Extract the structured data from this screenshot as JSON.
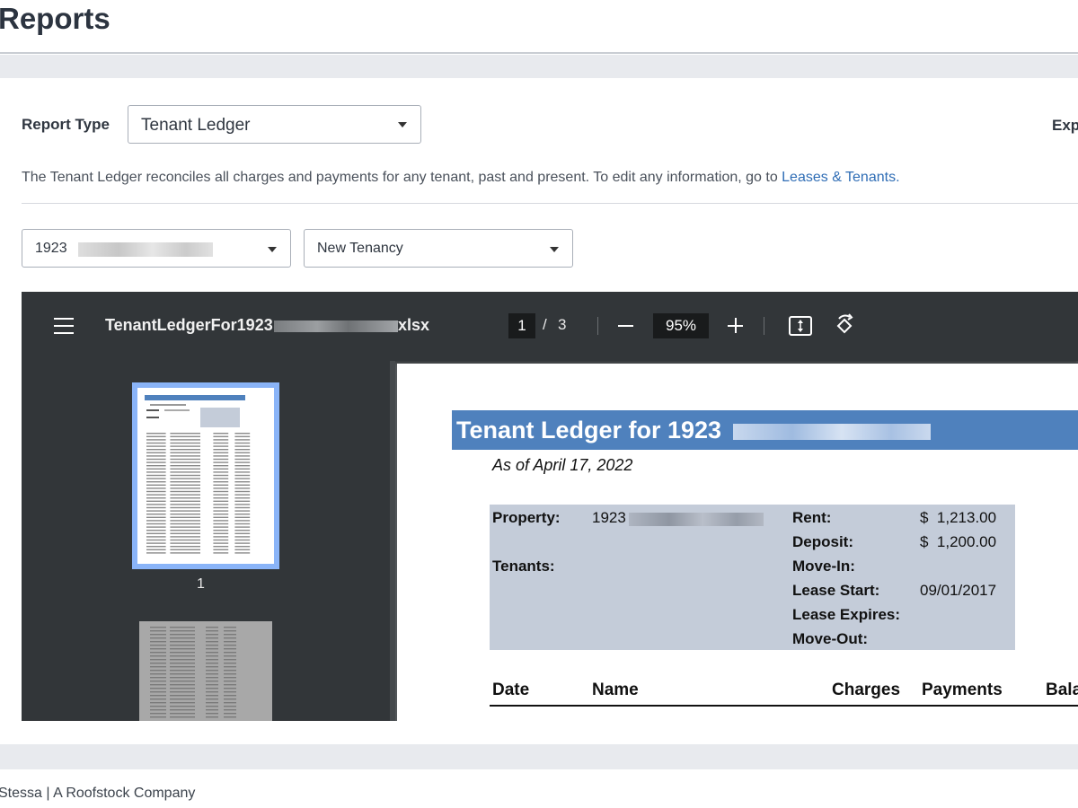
{
  "header": {
    "title": "Reports"
  },
  "report": {
    "type_label": "Report Type",
    "type_value": "Tenant Ledger",
    "export_label": "Exp",
    "description": "The Tenant Ledger reconciles all charges and payments for any tenant, past and present. To edit any information, go to ",
    "description_link": "Leases & Tenants."
  },
  "filters": {
    "property_value": "1923",
    "tenancy_value": "New Tenancy"
  },
  "viewer": {
    "file_name_prefix": "TenantLedgerFor1923",
    "file_ext": "xlsx",
    "page_current": "1",
    "page_separator": "/",
    "page_total": "3",
    "zoom": "95%",
    "thumbnail_label": "1",
    "icons": [
      "menu-icon",
      "zoom-out-icon",
      "zoom-in-icon",
      "fit-page-icon",
      "rotate-icon"
    ]
  },
  "document": {
    "title": "Tenant Ledger for 1923",
    "as_of": "As of April 17, 2022",
    "property_label": "Property:",
    "property_value": "1923",
    "tenants_label": "Tenants:",
    "rent_label": "Rent:",
    "rent_value": "$  1,213.00",
    "deposit_label": "Deposit:",
    "deposit_value": "$  1,200.00",
    "move_in_label": "Move-In:",
    "lease_start_label": "Lease Start:",
    "lease_start_value": "09/01/2017",
    "lease_expires_label": "Lease Expires:",
    "move_out_label": "Move-Out:",
    "columns": [
      "Date",
      "Name",
      "Charges",
      "Payments",
      "Bala"
    ]
  },
  "footer": {
    "text": "Stessa | A Roofstock Company"
  },
  "colors": {
    "title_bar": "#4f81bd",
    "info_box": "#c4ccd9",
    "link": "#2f6db5",
    "viewer_toolbar": "#323639",
    "thumb_highlight": "#8ab4f8"
  }
}
